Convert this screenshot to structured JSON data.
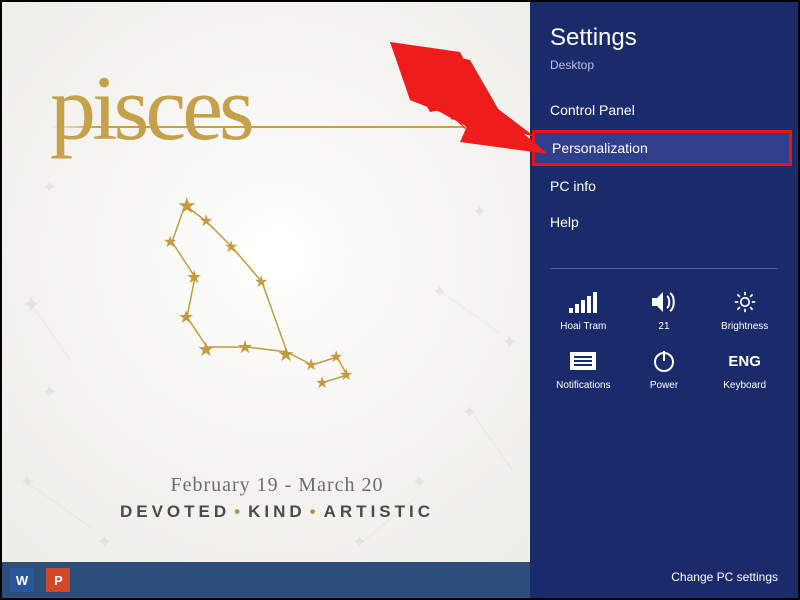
{
  "wallpaper": {
    "script_title": "pisces",
    "date_range": "February 19 - March 20",
    "trait1": "DEVOTED",
    "trait2": "KIND",
    "trait3": "ARTISTIC"
  },
  "taskbar": {
    "apps": [
      "Word",
      "PowerPoint"
    ]
  },
  "charm": {
    "title": "Settings",
    "context": "Desktop",
    "items": [
      {
        "label": "Control Panel"
      },
      {
        "label": "Personalization",
        "highlighted": true
      },
      {
        "label": "PC info"
      },
      {
        "label": "Help"
      }
    ],
    "tiles": {
      "network": {
        "label": "Hoai Tram"
      },
      "volume": {
        "label": "21"
      },
      "brightness": {
        "label": "Brightness"
      },
      "notifications": {
        "label": "Notifications"
      },
      "power": {
        "label": "Power"
      },
      "keyboard": {
        "label": "Keyboard",
        "value": "ENG"
      }
    },
    "change_link": "Change PC settings"
  }
}
